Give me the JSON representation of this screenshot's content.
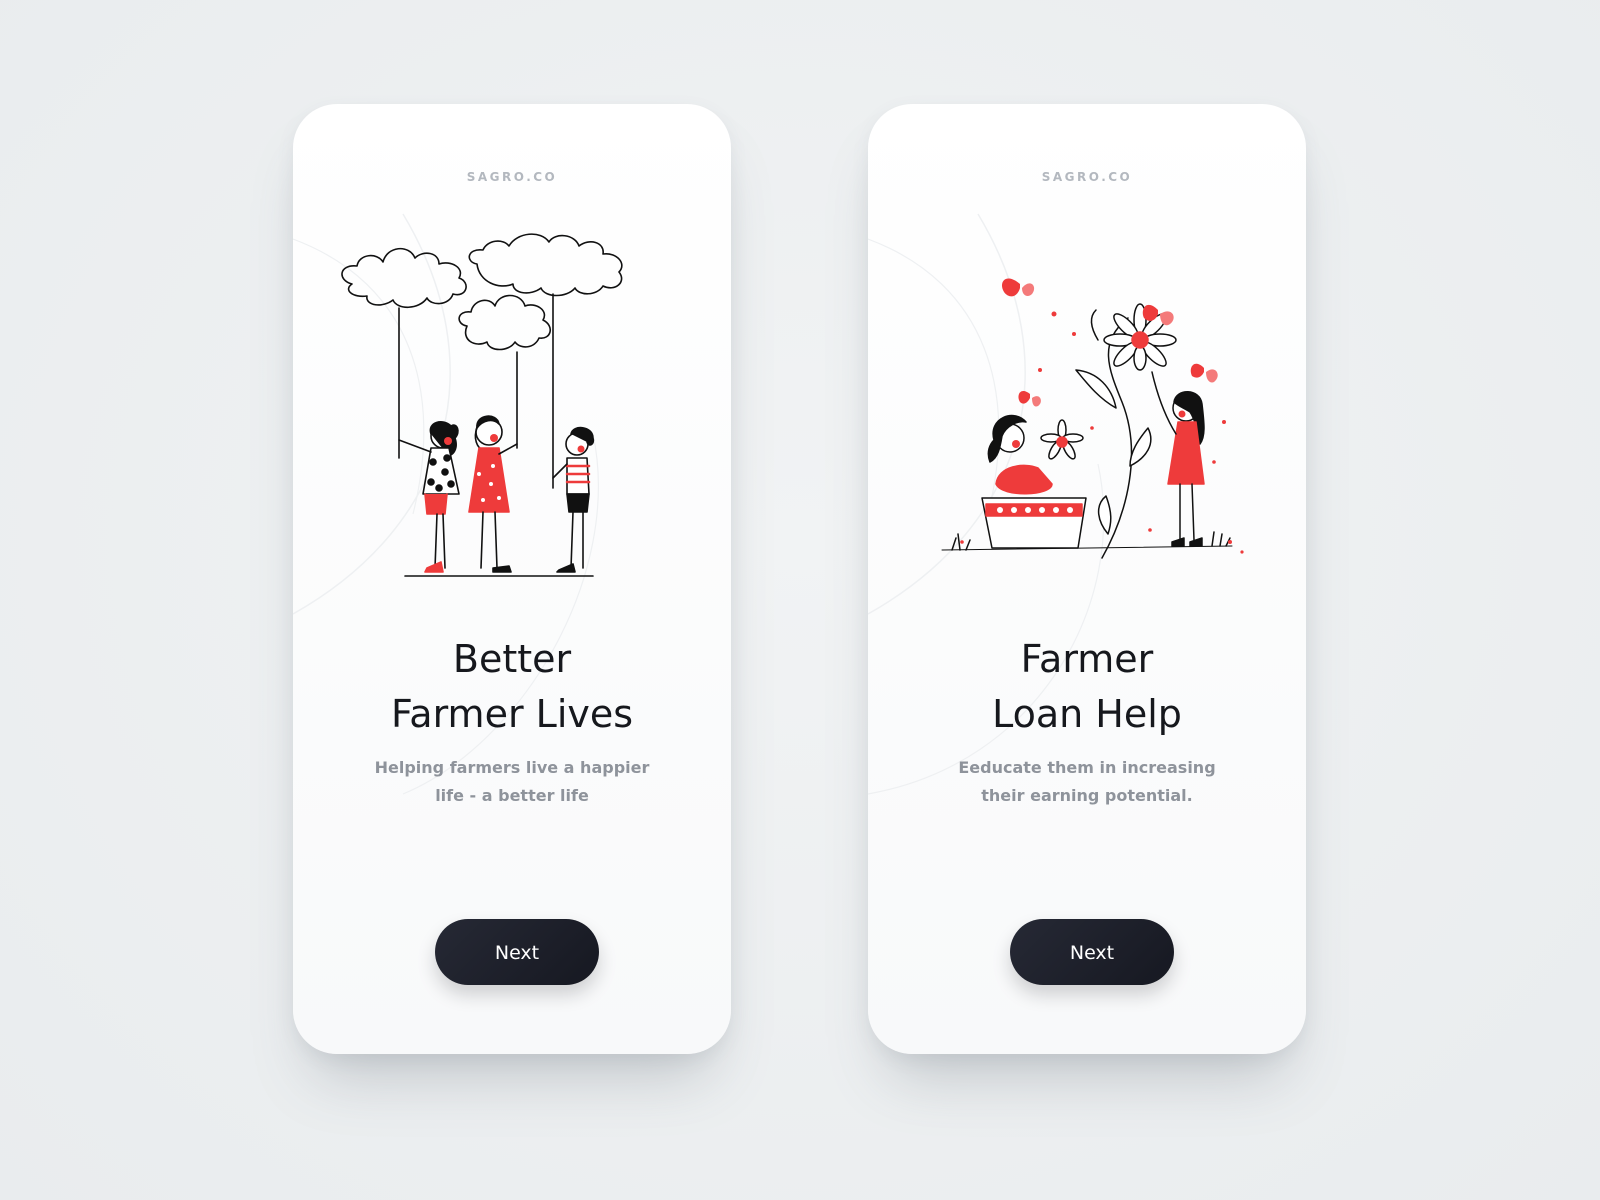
{
  "colors": {
    "background": "#eceff1",
    "card": "#ffffff",
    "accent": "#ee3b3b",
    "button": "#1c1f29",
    "title": "#16181d",
    "subtitle": "#8e939b",
    "brand": "#b3b8bf"
  },
  "screens": [
    {
      "brand": "SAGRO.CO",
      "illustration": "children-holding-cloud-balloons",
      "title_line1": "Better",
      "title_line2": "Farmer Lives",
      "subtitle": "Helping farmers live a happier life - a better life",
      "button_label": "Next"
    },
    {
      "brand": "SAGRO.CO",
      "illustration": "girls-with-flowers-and-butterflies",
      "title_line1": "Farmer",
      "title_line2": "Loan Help",
      "subtitle": "Eeducate them in increasing their earning potential.",
      "button_label": "Next"
    }
  ]
}
